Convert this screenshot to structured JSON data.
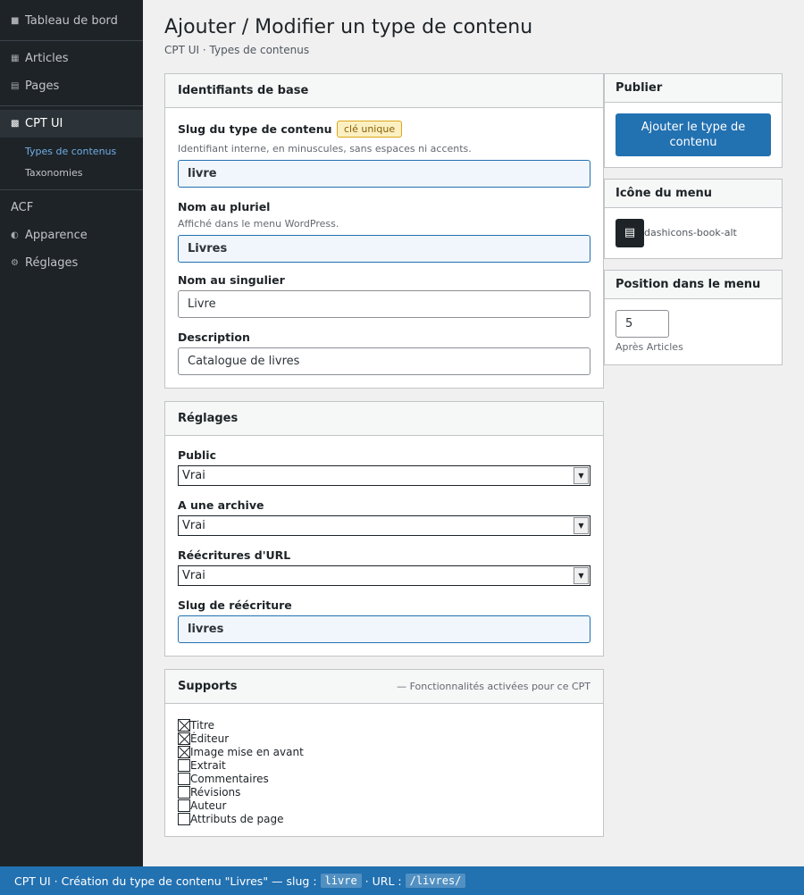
{
  "sidebar": {
    "dashboard": {
      "icon": "dashboard-icon",
      "label": "Tableau de bord"
    },
    "items_top": [
      {
        "icon": "pushpin-icon",
        "label": "Articles"
      },
      {
        "icon": "page-icon",
        "label": "Pages"
      }
    ],
    "active": {
      "icon": "cpt-icon",
      "label": "CPT UI"
    },
    "submenu": [
      {
        "label": "Types de contenus",
        "current": true
      },
      {
        "label": "Taxonomies",
        "current": false
      }
    ],
    "items_bottom": [
      {
        "icon": "",
        "label": "ACF"
      },
      {
        "icon": "brush-icon",
        "label": "Apparence"
      },
      {
        "icon": "gear-icon",
        "label": "Réglages"
      }
    ]
  },
  "header": {
    "title": "Ajouter / Modifier un type de contenu",
    "breadcrumb": "CPT UI · Types de contenus"
  },
  "basics": {
    "heading": "Identifiants de base",
    "slug_label": "Slug du type de contenu",
    "slug_badge": "clé unique",
    "slug_help": "Identifiant interne, en minuscules, sans espaces ni accents.",
    "slug_value": "livre",
    "plural_label": "Nom au pluriel",
    "plural_help": "Affiché dans le menu WordPress.",
    "plural_value": "Livres",
    "singular_label": "Nom au singulier",
    "singular_value": "Livre",
    "description_label": "Description",
    "description_value": "Catalogue de livres"
  },
  "settings": {
    "heading": "Réglages",
    "public_label": "Public",
    "public_value": "Vrai",
    "archive_label": "A une archive",
    "archive_value": "Vrai",
    "rewrite_label": "Réécritures d'URL",
    "rewrite_value": "Vrai",
    "rewrite_slug_label": "Slug de réécriture",
    "rewrite_slug_value": "livres"
  },
  "supports": {
    "heading": "Supports",
    "note": "— Fonctionnalités activées pour ce CPT",
    "items": [
      {
        "label": "Titre",
        "checked": true
      },
      {
        "label": "Éditeur",
        "checked": true
      },
      {
        "label": "Image mise en avant",
        "checked": true
      },
      {
        "label": "Extrait",
        "checked": false
      },
      {
        "label": "Commentaires",
        "checked": false
      },
      {
        "label": "Révisions",
        "checked": false
      },
      {
        "label": "Auteur",
        "checked": false
      },
      {
        "label": "Attributs de page",
        "checked": false
      }
    ]
  },
  "publish": {
    "heading": "Publier",
    "button_label": "Ajouter le type de contenu"
  },
  "menu_icon": {
    "heading": "Icône du menu",
    "icon_name": "dashicons-book-alt"
  },
  "menu_position": {
    "heading": "Position dans le menu",
    "value": "5",
    "help": "Après Articles"
  },
  "footer": {
    "prefix": "CPT UI · Création du type de contenu \"Livres\" — slug :",
    "slug": "livre",
    "middle": "· URL :",
    "url": "/livres/"
  },
  "colors": {
    "sidebar_bg": "#1d2327",
    "accent": "#2271b1",
    "page_bg": "#f0f0f1"
  }
}
